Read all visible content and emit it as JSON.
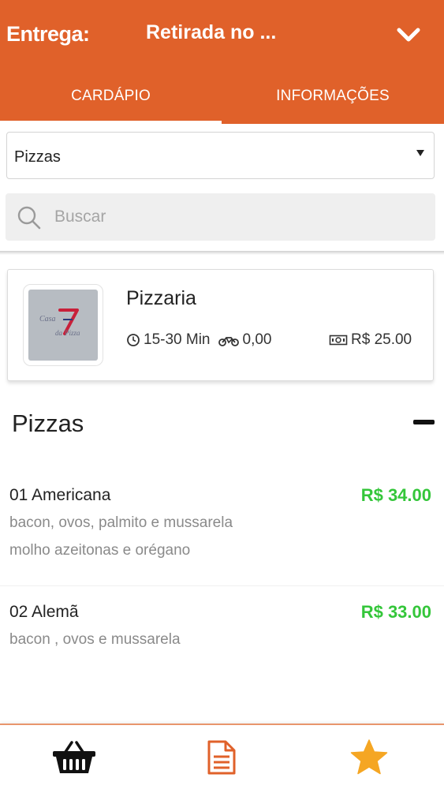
{
  "header": {
    "delivery_label": "Entrega:",
    "delivery_value": "Retirada no ...",
    "tabs": [
      {
        "label": "CARDÁPIO",
        "active": true
      },
      {
        "label": "INFORMAÇÕES",
        "active": false
      }
    ],
    "background_color": "#e0612a"
  },
  "category_select": {
    "value": "Pizzas"
  },
  "search": {
    "placeholder": "Buscar",
    "value": ""
  },
  "store": {
    "name": "Pizzaria",
    "time": "15-30 Min",
    "delivery_fee": "0,00",
    "min_order": "R$ 25.00",
    "logo_icon": "store-logo"
  },
  "section": {
    "title": "Pizzas"
  },
  "items": [
    {
      "name": "01 Americana",
      "price": "R$ 34.00",
      "desc_lines": [
        "bacon, ovos, palmito e mussarela",
        "molho azeitonas e orégano"
      ]
    },
    {
      "name": "02 Alemã",
      "price": "R$ 33.00",
      "desc_lines": [
        "bacon , ovos e mussarela"
      ]
    }
  ],
  "colors": {
    "accent": "#e0612a",
    "price": "#34c63a",
    "star": "#f5a623"
  },
  "bottom_nav": [
    {
      "icon": "basket-icon"
    },
    {
      "icon": "document-icon"
    },
    {
      "icon": "star-icon"
    }
  ]
}
